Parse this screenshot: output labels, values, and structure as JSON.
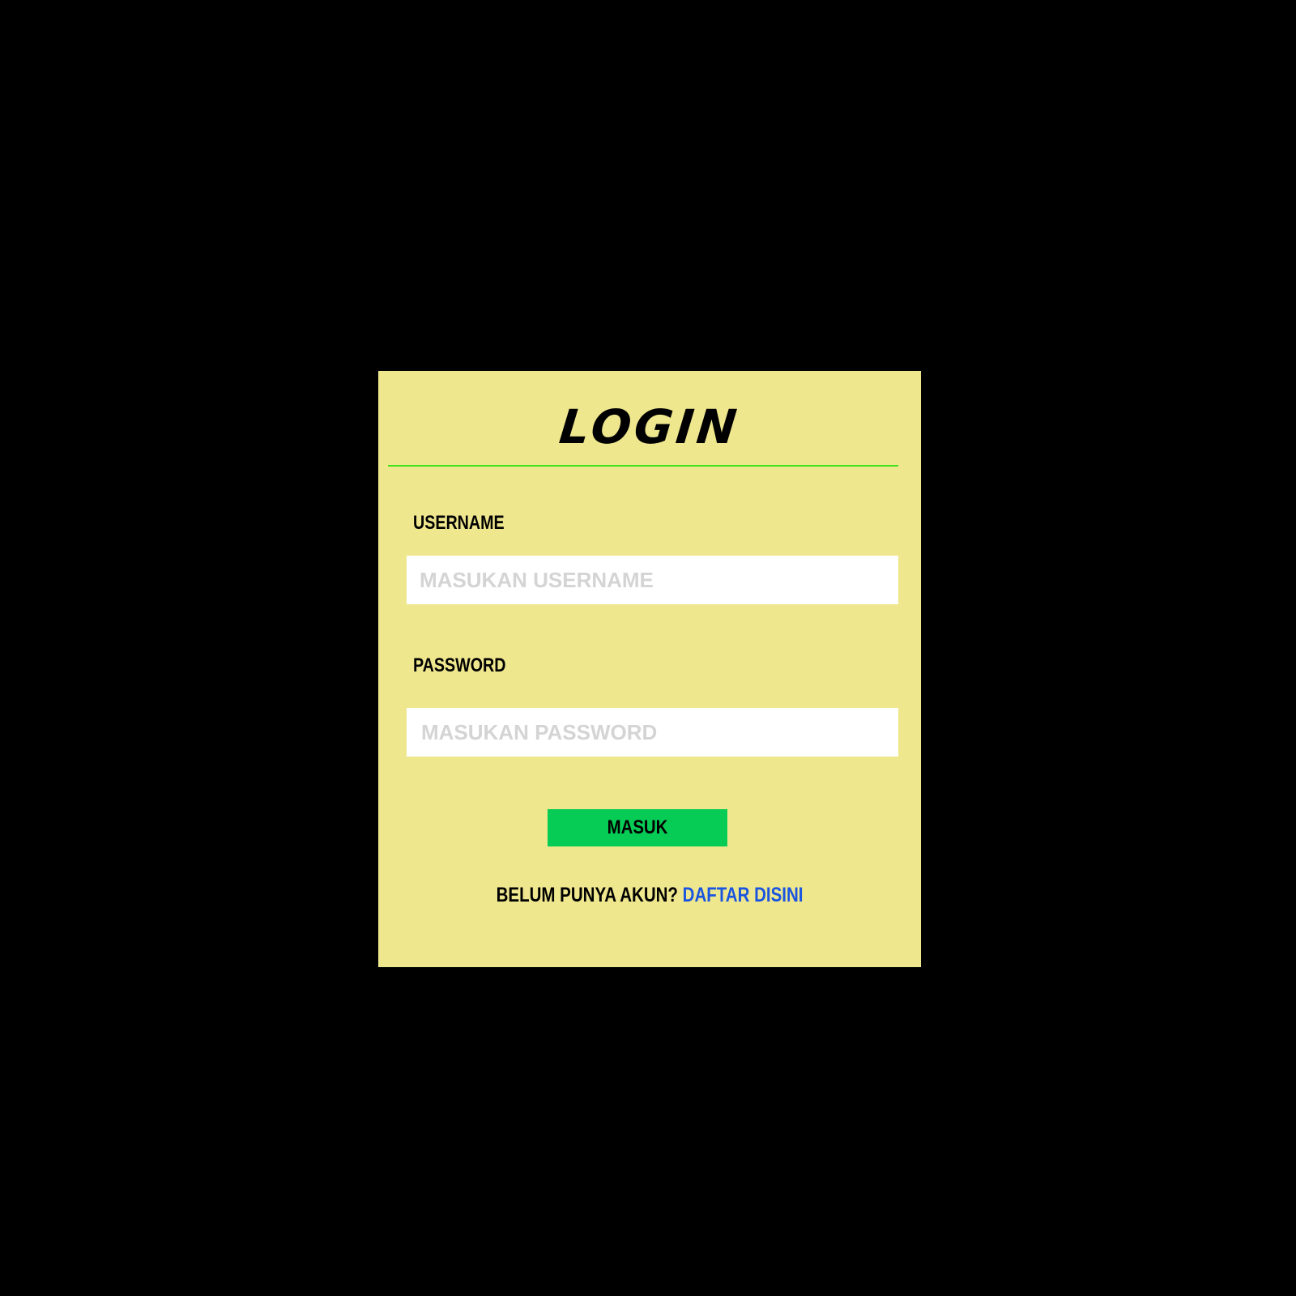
{
  "page": {
    "background": "#000000"
  },
  "card": {
    "background": "#efe78e",
    "title": "LOGIN",
    "divider_color": "#3ee21a"
  },
  "form": {
    "username": {
      "label": "USERNAME",
      "placeholder": "MASUKAN USERNAME",
      "value": ""
    },
    "password": {
      "label": "PASSWORD",
      "placeholder": "MASUKAN PASSWORD",
      "value": ""
    },
    "submit": {
      "label": "MASUK",
      "color": "#06cc55"
    }
  },
  "signup": {
    "prompt": "BELUM PUNYA AKUN?",
    "link_label": "DAFTAR DISINI",
    "link_color": "#1a55e0"
  }
}
